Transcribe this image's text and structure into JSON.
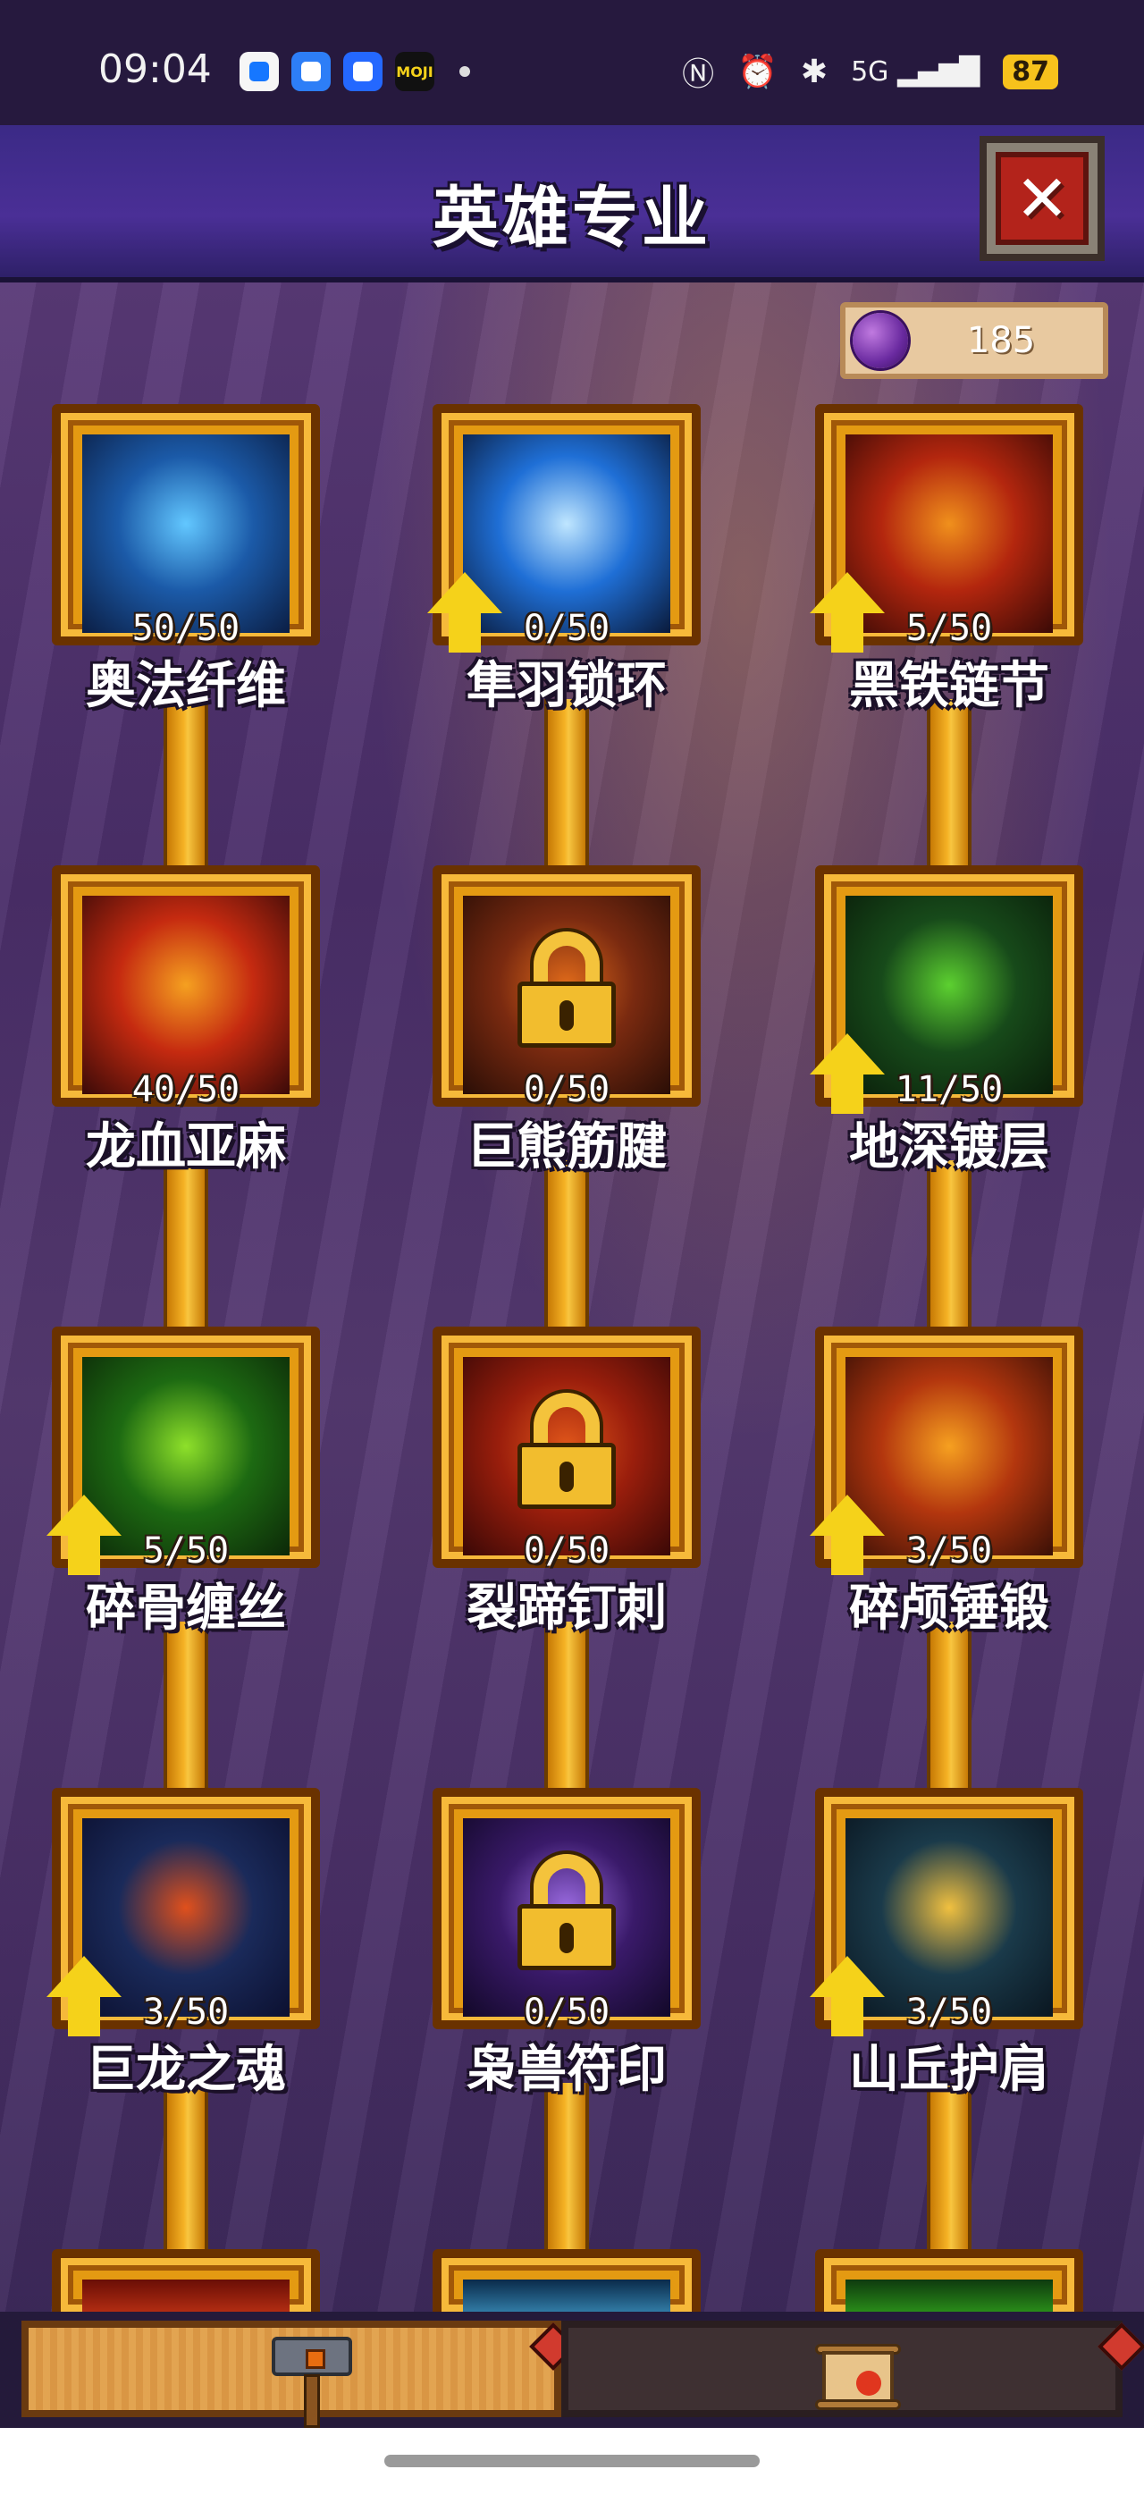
{
  "status_bar": {
    "time": "09:04",
    "apps": [
      {
        "icon": "wallet-app-icon",
        "bg": "#f6f6f6",
        "fg": "#1677ff",
        "text": ""
      },
      {
        "icon": "browser-app-icon",
        "bg": "#2d7ef7",
        "fg": "#ffffff",
        "text": ""
      },
      {
        "icon": "messenger-app-icon",
        "bg": "#2468ff",
        "fg": "#ffffff",
        "text": ""
      },
      {
        "icon": "moji-weather-icon",
        "bg": "#111111",
        "fg": "#f5d21a",
        "text": "MOJI"
      }
    ],
    "signal_text": "5G",
    "battery": "87"
  },
  "header": {
    "title": "英雄专业",
    "close_glyph": "✕"
  },
  "currency": {
    "icon": "purple-essence-orb-icon",
    "amount": "185"
  },
  "nodes": [
    {
      "id": "arcane-fiber",
      "name": "奥法纤维",
      "progress": "50/50",
      "locked": false,
      "upgradable": false,
      "theme": [
        "#1b5aa8",
        "#62c7ff",
        "#0b1e44"
      ]
    },
    {
      "id": "bird-feather-chain",
      "name": "隼羽锁环",
      "progress": "0/50",
      "locked": false,
      "upgradable": true,
      "theme": [
        "#1f6fd6",
        "#bfe6ff",
        "#0a1a3a"
      ]
    },
    {
      "id": "black-iron-chain",
      "name": "黑铁链节",
      "progress": "5/50",
      "locked": false,
      "upgradable": true,
      "theme": [
        "#b3260e",
        "#f0901c",
        "#3a0a06"
      ]
    },
    {
      "id": "dragon-blood-linen",
      "name": "龙血亚麻",
      "progress": "40/50",
      "locked": false,
      "upgradable": false,
      "theme": [
        "#c52a10",
        "#f5a020",
        "#3a0a08"
      ]
    },
    {
      "id": "giant-bear-tendon",
      "name": "巨熊筋腱",
      "progress": "0/50",
      "locked": true,
      "upgradable": false,
      "theme": [
        "#7a2a10",
        "#e06a1a",
        "#2a0e06"
      ]
    },
    {
      "id": "deep-earth-plating",
      "name": "地深镀层",
      "progress": "11/50",
      "locked": false,
      "upgradable": true,
      "theme": [
        "#174a1a",
        "#5cd030",
        "#0a1e0a"
      ]
    },
    {
      "id": "bone-crush-wire",
      "name": "碎骨缠丝",
      "progress": "5/50",
      "locked": false,
      "upgradable": true,
      "theme": [
        "#1d6a12",
        "#8ee02a",
        "#0c2808"
      ]
    },
    {
      "id": "split-hoof-spike",
      "name": "裂蹄钉刺",
      "progress": "0/50",
      "locked": true,
      "upgradable": false,
      "theme": [
        "#9a1e0c",
        "#e0561a",
        "#3a0806"
      ]
    },
    {
      "id": "skull-crush-hammer",
      "name": "碎颅锤锻",
      "progress": "3/50",
      "locked": false,
      "upgradable": true,
      "theme": [
        "#b3360e",
        "#f6a020",
        "#3a1006"
      ]
    },
    {
      "id": "dragon-soul",
      "name": "巨龙之魂",
      "progress": "3/50",
      "locked": false,
      "upgradable": true,
      "theme": [
        "#1a2a5a",
        "#e0501c",
        "#0c1030"
      ]
    },
    {
      "id": "beast-sigil",
      "name": "枭兽符印",
      "progress": "0/50",
      "locked": true,
      "upgradable": false,
      "theme": [
        "#3a1a6a",
        "#9a6ae0",
        "#120828"
      ]
    },
    {
      "id": "mountain-shoulder",
      "name": "山丘护肩",
      "progress": "3/50",
      "locked": false,
      "upgradable": true,
      "theme": [
        "#1a3a4a",
        "#f0c040",
        "#0a1620"
      ]
    }
  ],
  "partial_row_themes": [
    [
      "#6a0e06",
      "#e0401a"
    ],
    [
      "#0a2a4a",
      "#4ab0e0"
    ],
    [
      "#0e3a0e",
      "#3ac020"
    ]
  ],
  "bottom_tabs": [
    {
      "id": "forge",
      "icon": "war-hammer-icon",
      "active": true
    },
    {
      "id": "scroll",
      "icon": "fire-scroll-icon",
      "active": false
    }
  ],
  "colors": {
    "frame_gold": "#e49a12",
    "frame_dark": "#6a3200",
    "arrow_yellow": "#f5d21a",
    "header_purple": "#3b2a86",
    "close_red": "#b3231b"
  }
}
